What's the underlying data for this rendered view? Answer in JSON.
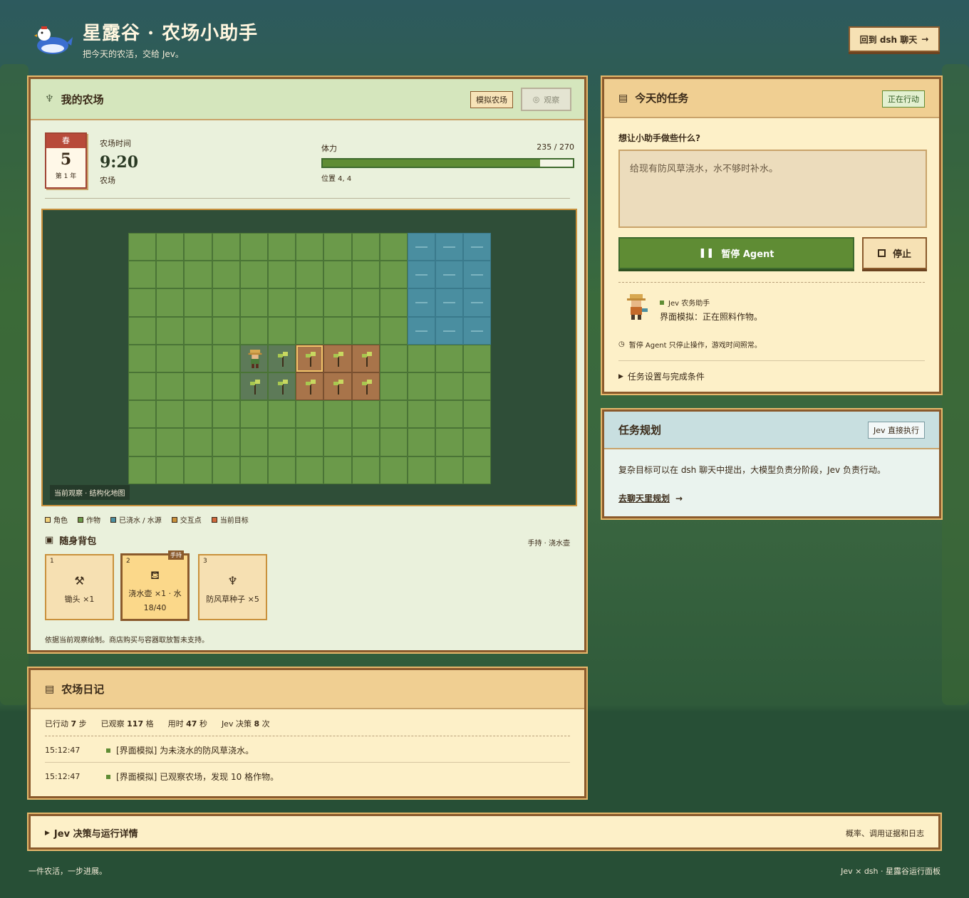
{
  "header": {
    "title": "星露谷 · 农场小助手",
    "subtitle": "把今天的农活，交给 Jev。",
    "back_button": "回到 dsh 聊天"
  },
  "farm": {
    "title": "我的农场",
    "mode_tag": "模拟农场",
    "observe_button": "观察",
    "calendar": {
      "season": "春",
      "day": "5",
      "year": "第 1 年"
    },
    "time_label": "农场时间",
    "time": "9:20",
    "location": "农场",
    "stamina_label": "体力",
    "stamina_text": "235 / 270",
    "stamina_fraction": 0.87,
    "position": "位置 4, 4",
    "map_label": "当前观察 · 结构化地图",
    "legend": [
      "角色",
      "作物",
      "已浇水 / 水源",
      "交互点",
      "当前目标"
    ],
    "legend_colors": [
      "#f2d27a",
      "#6b9a4a",
      "#4a8ea0",
      "#c9913c",
      "#d0683c"
    ],
    "inventory_title": "随身背包",
    "holding": "手持 · 浇水壶",
    "slots": [
      {
        "num": "1",
        "name": "锄头 ×1",
        "sub": "",
        "icon": "hoe-icon"
      },
      {
        "num": "2",
        "name": "浇水壶 ×1 · 水",
        "sub": "18/40",
        "icon": "watering-can-icon",
        "badge": "手持"
      },
      {
        "num": "3",
        "name": "防风草种子 ×5",
        "sub": "",
        "icon": "seed-icon"
      }
    ],
    "note": "依据当前观察绘制。商店购买与容器取放暂未支持。"
  },
  "task": {
    "title": "今天的任务",
    "status": "正在行动",
    "prompt_label": "想让小助手做些什么?",
    "prompt_value": "给现有防风草浇水，水不够时补水。",
    "pause_button": "暂停 Agent",
    "stop_button": "停止",
    "agent_name": "Jev 农务助手",
    "agent_msg": "界面模拟：正在照料作物。",
    "hint": "暂停 Agent 只停止操作，游戏时间照常。",
    "settings": "任务设置与完成条件"
  },
  "plan": {
    "title": "任务规划",
    "tag": "Jev 直接执行",
    "desc": "复杂目标可以在 dsh 聊天中提出，大模型负责分阶段，Jev 负责行动。",
    "link": "去聊天里规划"
  },
  "diary": {
    "title": "农场日记",
    "stats": [
      {
        "pre": "已行动",
        "val": "7",
        "unit": "步"
      },
      {
        "pre": "已观察",
        "val": "117",
        "unit": "格"
      },
      {
        "pre": "用时",
        "val": "47",
        "unit": "秒"
      },
      {
        "pre": "Jev 决策",
        "val": "8",
        "unit": "次"
      }
    ],
    "entries": [
      {
        "time": "15:12:47",
        "text": "[界面模拟] 为未浇水的防风草浇水。"
      },
      {
        "time": "15:12:47",
        "text": "[界面模拟] 已观察农场，发现 10 格作物。"
      }
    ]
  },
  "details": {
    "title": "Jev 决策与运行详情",
    "right": "概率、调用证据和日志"
  },
  "footer": {
    "left": "一件农活，一步进展。",
    "right": "Jev × dsh · 星露谷运行面板"
  }
}
